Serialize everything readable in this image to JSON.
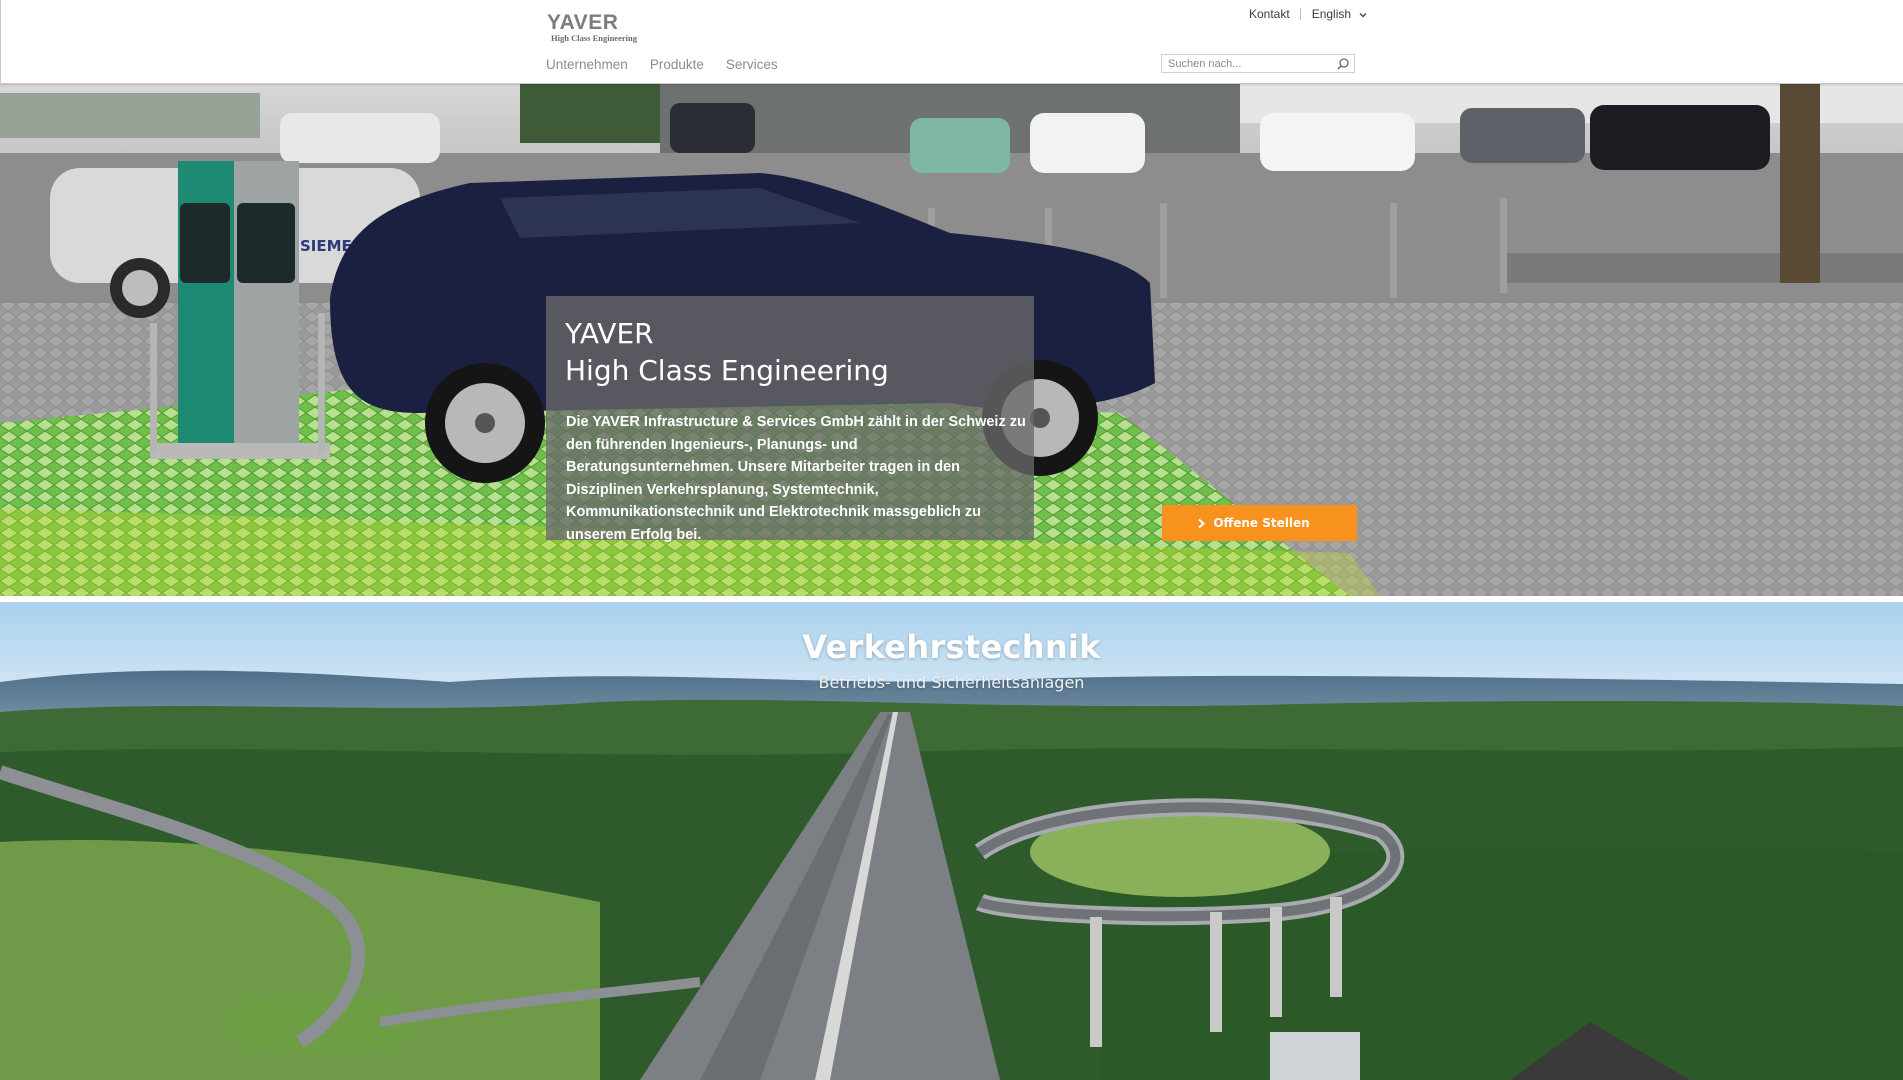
{
  "header": {
    "logo_text": "YAVER",
    "logo_subtext": "High Class Engineering",
    "nav": [
      {
        "label": "Unternehmen"
      },
      {
        "label": "Produkte"
      },
      {
        "label": "Services"
      }
    ],
    "topbar": {
      "contact_label": "Kontakt",
      "language_label": "English"
    },
    "search": {
      "placeholder": "Suchen nach..."
    }
  },
  "hero": {
    "title_line1": "YAVER",
    "title_line2": "High Class Engineering",
    "text": "Die YAVER Infrastructure & Services GmbH zählt in der Schweiz zu den führenden Ingenieurs-, Planungs- und Beratungsunternehmen. Unsere Mitarbeiter tragen in den Disziplinen Verkehrsplanung, Systemtechnik, Kommunikationstechnik und Elektrotechnik massgeblich zu unserem Erfolg bei.",
    "button_label": "Offene Stellen",
    "button_icon": "chevron-right-icon",
    "button_color": "#f7921e",
    "image_sign_text": "SIEMENS"
  },
  "section2": {
    "title": "Verkehrstechnik",
    "subtitle": "Betriebs- und Sicherheitsanlagen"
  }
}
